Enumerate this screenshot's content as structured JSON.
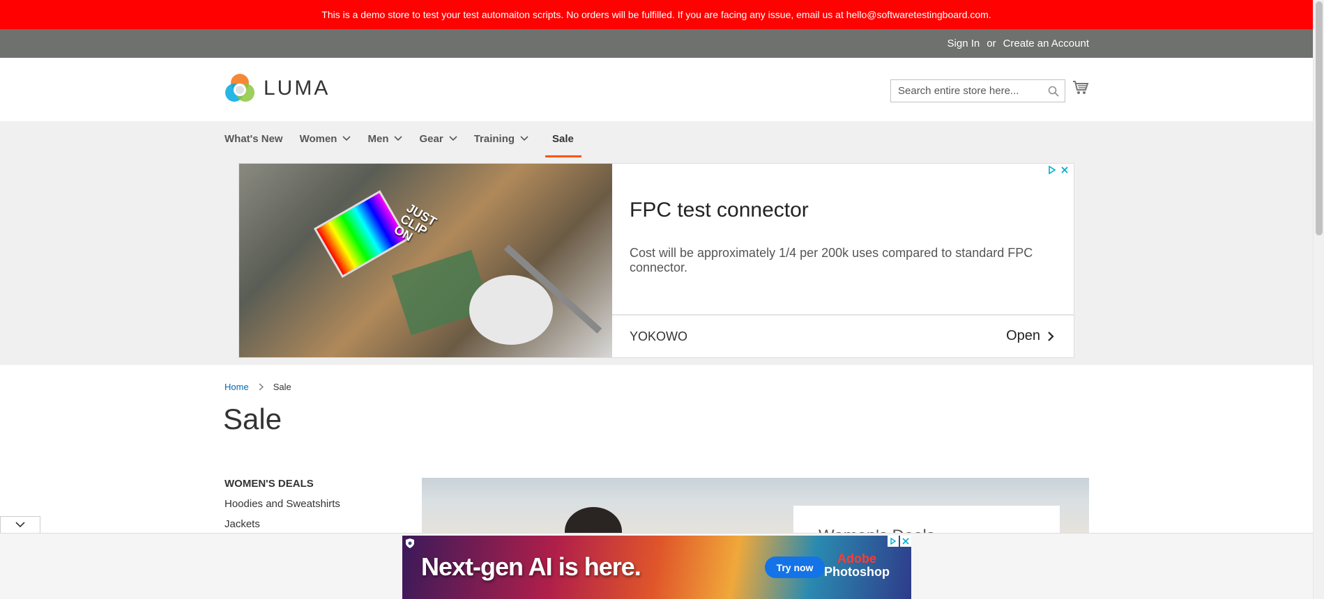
{
  "notice": "This is a demo store to test your test automaiton scripts. No orders will be fulfilled. If you are facing any issue, email us at hello@softwaretestingboard.com.",
  "header": {
    "sign_in": "Sign In",
    "or": "or",
    "create_account": "Create an Account"
  },
  "logo": {
    "text": "LUMA"
  },
  "search": {
    "placeholder": "Search entire store here..."
  },
  "nav": {
    "items": [
      {
        "label": "What's New"
      },
      {
        "label": "Women"
      },
      {
        "label": "Men"
      },
      {
        "label": "Gear"
      },
      {
        "label": "Training"
      },
      {
        "label": "Sale"
      }
    ]
  },
  "ad": {
    "image_text": "JUST CLIP ON",
    "headline": "FPC test connector",
    "body": "Cost will be approximately 1/4 per 200k uses compared to standard FPC connector.",
    "brand": "YOKOWO",
    "cta": "Open"
  },
  "breadcrumbs": {
    "home": "Home",
    "current": "Sale"
  },
  "page_title": "Sale",
  "sidebar": {
    "heading": "WOMEN'S DEALS",
    "items": [
      {
        "label": "Hoodies and Sweatshirts"
      },
      {
        "label": "Jackets"
      }
    ]
  },
  "promo": {
    "title": "Women's Deals"
  },
  "bottom_ad": {
    "headline": "Next-gen AI is here.",
    "cta": "Try now",
    "brand_line1": "Adobe",
    "brand_line2": "Photoshop"
  },
  "colors": {
    "notice_bg": "#ff0101",
    "header_panel_bg": "#6e716e",
    "nav_bg": "#f0f0f0",
    "active_nav_underline": "#ff5501",
    "link_blue": "#006bb4"
  }
}
